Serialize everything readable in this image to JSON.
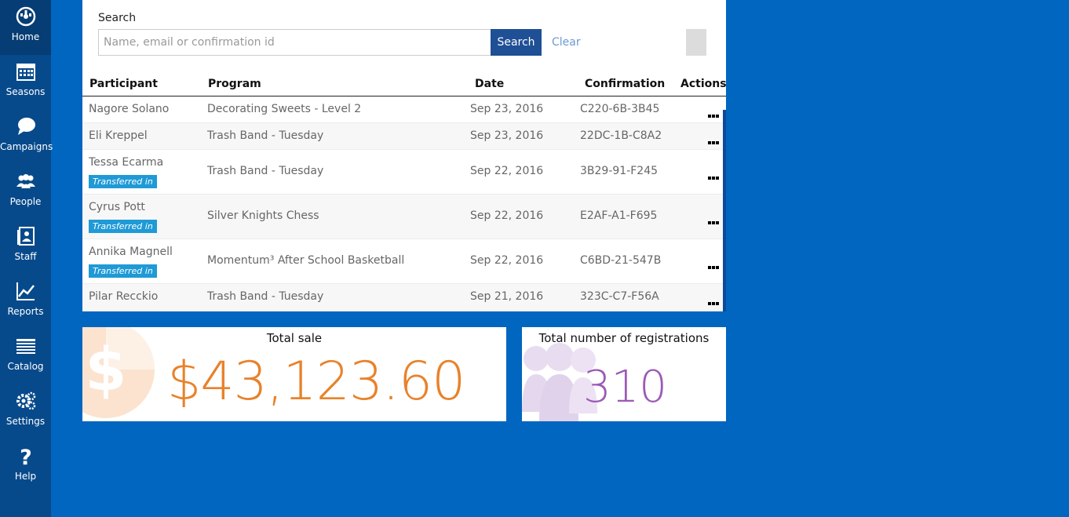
{
  "sidebar": {
    "items": [
      {
        "label": "Home",
        "icon": "home-icon"
      },
      {
        "label": "Seasons",
        "icon": "calendar-icon"
      },
      {
        "label": "Campaigns",
        "icon": "chat-icon"
      },
      {
        "label": "People",
        "icon": "people-icon"
      },
      {
        "label": "Staff",
        "icon": "staff-icon"
      },
      {
        "label": "Reports",
        "icon": "chart-icon"
      },
      {
        "label": "Catalog",
        "icon": "catalog-icon"
      },
      {
        "label": "Settings",
        "icon": "gear-icon"
      },
      {
        "label": "Help",
        "icon": "question-icon"
      }
    ]
  },
  "search": {
    "label": "Search",
    "placeholder": "Name, email or confirmation id",
    "value": "",
    "button_label": "Search",
    "clear_label": "Clear"
  },
  "table": {
    "headers": {
      "participant": "Participant",
      "program": "Program",
      "date": "Date",
      "confirmation": "Confirmation",
      "actions": "Actions"
    },
    "rows": [
      {
        "participant": "Nagore Solano",
        "program": "Decorating Sweets - Level 2",
        "date": "Sep 23, 2016",
        "confirmation": "C220-6B-3B45",
        "badge": ""
      },
      {
        "participant": "Eli Kreppel",
        "program": "Trash Band - Tuesday",
        "date": "Sep 23, 2016",
        "confirmation": "22DC-1B-C8A2",
        "badge": ""
      },
      {
        "participant": "Tessa Ecarma",
        "program": "Trash Band - Tuesday",
        "date": "Sep 22, 2016",
        "confirmation": "3B29-91-F245",
        "badge": "Transferred in"
      },
      {
        "participant": "Cyrus Pott",
        "program": "Silver Knights Chess",
        "date": "Sep 22, 2016",
        "confirmation": "E2AF-A1-F695",
        "badge": "Transferred in"
      },
      {
        "participant": "Annika Magnell",
        "program": "Momentum³ After School Basketball",
        "date": "Sep 22, 2016",
        "confirmation": "C6BD-21-547B",
        "badge": "Transferred in"
      },
      {
        "participant": "Pilar Recckio",
        "program": "Trash Band - Tuesday",
        "date": "Sep 21, 2016",
        "confirmation": "323C-C7-F56A",
        "badge": ""
      }
    ]
  },
  "stats": {
    "total_sale": {
      "title": "Total sale",
      "value": "$43,123.60",
      "color": "#e8822a",
      "icon": "dollar-icon"
    },
    "total_registrations": {
      "title": "Total number of registrations",
      "value": "310",
      "color": "#9b59b6",
      "icon": "people-icon"
    }
  },
  "colors": {
    "background": "#0066c0",
    "sidebar": "#074a8b",
    "search_button": "#1f4f95",
    "badge": "#1f9ad6"
  }
}
